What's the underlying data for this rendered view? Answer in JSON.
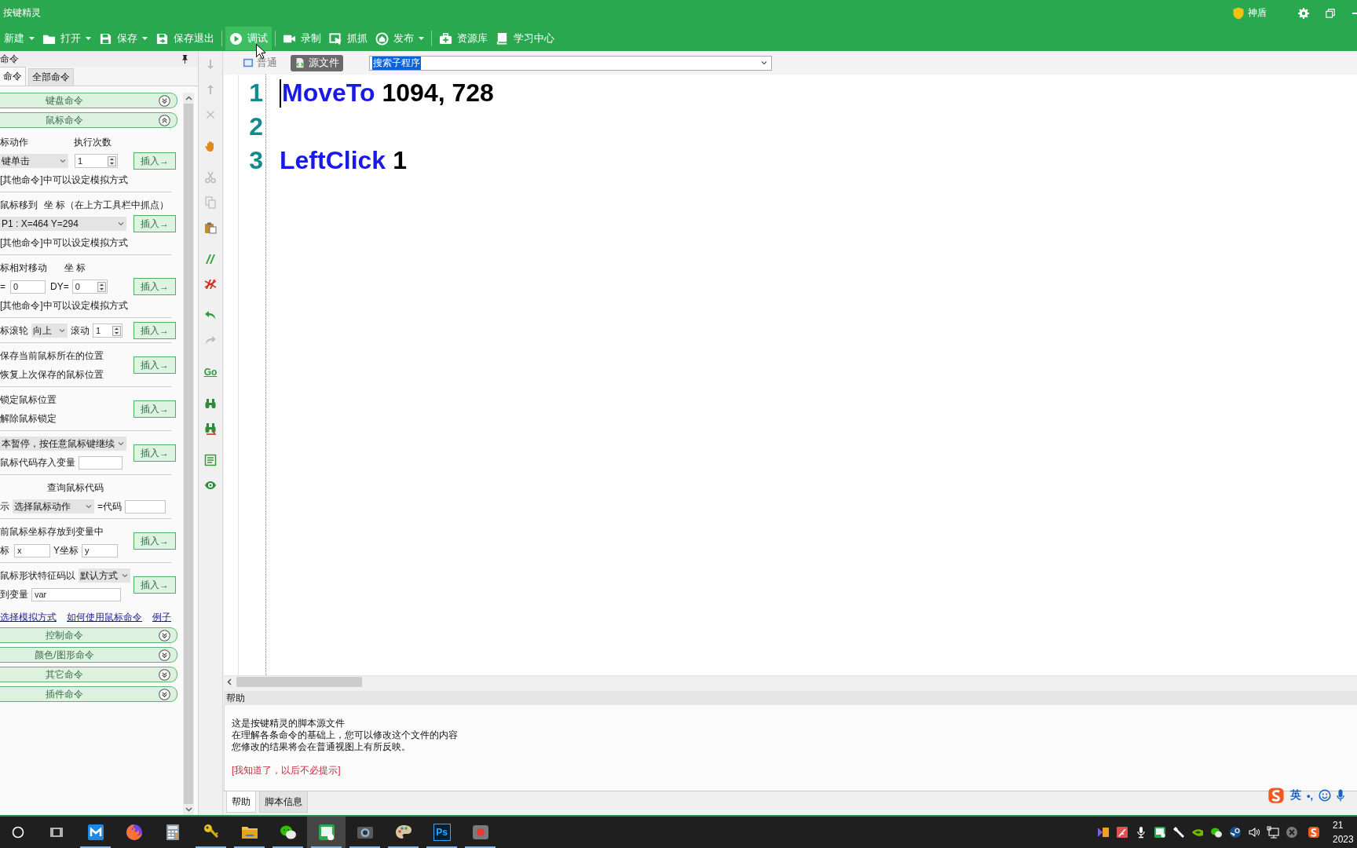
{
  "window": {
    "title": "按键精灵",
    "shield_label": "神盾"
  },
  "toolbar": {
    "groups": [
      {
        "items": [
          {
            "label": "新建",
            "dropdown": true,
            "highlighted": false
          },
          {
            "label": "打开",
            "dropdown": true,
            "highlighted": false
          },
          {
            "label": "保存",
            "dropdown": true,
            "highlighted": false
          },
          {
            "label": "保存退出",
            "dropdown": false,
            "highlighted": false
          }
        ]
      },
      {
        "items": [
          {
            "label": "调试",
            "dropdown": false,
            "highlighted": true
          }
        ]
      },
      {
        "items": [
          {
            "label": "录制",
            "dropdown": false,
            "highlighted": false
          },
          {
            "label": "抓抓",
            "dropdown": false,
            "highlighted": false
          },
          {
            "label": "发布",
            "dropdown": true,
            "highlighted": false
          }
        ]
      },
      {
        "items": [
          {
            "label": "资源库",
            "dropdown": false,
            "highlighted": false
          },
          {
            "label": "学习中心",
            "dropdown": false,
            "highlighted": false
          }
        ]
      }
    ]
  },
  "command_panel": {
    "title": "命令",
    "tabs": [
      {
        "label": "命令",
        "selected": true
      },
      {
        "label": "全部命令",
        "selected": false
      }
    ],
    "categories_top": [
      {
        "label": "键盘命令",
        "expanded": false
      },
      {
        "label": "鼠标命令",
        "expanded": true
      }
    ],
    "sections": [
      {
        "rows": [
          {
            "parts": [
              {
                "kind": "text",
                "text": "标动作"
              },
              {
                "kind": "text",
                "text": "执行次数"
              }
            ]
          },
          {
            "parts": [
              {
                "kind": "select",
                "value": "键单击"
              },
              {
                "kind": "spin",
                "value": "1"
              }
            ]
          },
          {
            "parts": [
              {
                "kind": "text",
                "text": "[其他命令]中可以设定模拟方式"
              }
            ]
          }
        ],
        "button": "插入→"
      },
      {
        "rows": [
          {
            "parts": [
              {
                "kind": "text",
                "text": "鼠标移到"
              },
              {
                "kind": "text",
                "text": "坐 标（在上方工具栏中抓点）"
              }
            ]
          },
          {
            "parts": [
              {
                "kind": "select",
                "value": "P1 : X=464 Y=294"
              }
            ]
          },
          {
            "parts": [
              {
                "kind": "text",
                "text": "[其他命令]中可以设定模拟方式"
              }
            ]
          }
        ],
        "button": "插入→"
      },
      {
        "rows": [
          {
            "parts": [
              {
                "kind": "text",
                "text": "标相对移动"
              },
              {
                "kind": "text",
                "text": "坐 标"
              }
            ]
          },
          {
            "parts": [
              {
                "kind": "text",
                "text": "="
              },
              {
                "kind": "input",
                "value": "0"
              },
              {
                "kind": "text",
                "text": "DY="
              },
              {
                "kind": "spin",
                "value": "0"
              }
            ]
          },
          {
            "parts": [
              {
                "kind": "text",
                "text": "[其他命令]中可以设定模拟方式"
              }
            ]
          }
        ],
        "button": "插入→"
      },
      {
        "rows": [
          {
            "parts": [
              {
                "kind": "text",
                "text": "标滚轮"
              },
              {
                "kind": "select",
                "value": "向上"
              },
              {
                "kind": "text",
                "text": "滚动"
              },
              {
                "kind": "spin",
                "value": "1"
              }
            ]
          }
        ],
        "button": "插入→"
      },
      {
        "rows": [
          {
            "parts": [
              {
                "kind": "text",
                "text": "保存当前鼠标所在的位置"
              }
            ]
          },
          {
            "parts": [
              {
                "kind": "text",
                "text": "恢复上次保存的鼠标位置"
              }
            ]
          }
        ],
        "button": "插入→"
      },
      {
        "rows": [
          {
            "parts": [
              {
                "kind": "text",
                "text": "锁定鼠标位置"
              }
            ]
          },
          {
            "parts": [
              {
                "kind": "text",
                "text": "解除鼠标锁定"
              }
            ]
          }
        ],
        "button": "插入→"
      },
      {
        "rows": [
          {
            "parts": [
              {
                "kind": "select",
                "value": "本暂停，按任意鼠标键继续"
              }
            ]
          },
          {
            "parts": [
              {
                "kind": "text",
                "text": "鼠标代码存入变量"
              },
              {
                "kind": "input"
              }
            ]
          }
        ],
        "button": "插入→"
      },
      {
        "rows": [
          {
            "parts": [
              {
                "kind": "caption",
                "text": "查询鼠标代码"
              }
            ]
          },
          {
            "parts": [
              {
                "kind": "text",
                "text": "示"
              },
              {
                "kind": "select",
                "value": "选择鼠标动作"
              },
              {
                "kind": "text",
                "text": "=代码"
              },
              {
                "kind": "input"
              }
            ]
          }
        ]
      },
      {
        "rows": [
          {
            "parts": [
              {
                "kind": "text",
                "text": "前鼠标坐标存放到变量中"
              }
            ]
          },
          {
            "parts": [
              {
                "kind": "text",
                "text": "标"
              },
              {
                "kind": "input",
                "value": "x"
              },
              {
                "kind": "text",
                "text": "Y坐标"
              },
              {
                "kind": "input",
                "value": "y"
              }
            ]
          }
        ],
        "button": "插入→"
      },
      {
        "rows": [
          {
            "parts": [
              {
                "kind": "text",
                "text": "鼠标形状特征码以"
              },
              {
                "kind": "select",
                "value": "默认方式"
              }
            ]
          },
          {
            "parts": [
              {
                "kind": "text",
                "text": "到变量"
              },
              {
                "kind": "input",
                "value": "var"
              }
            ]
          }
        ],
        "button": "插入→"
      }
    ],
    "links": [
      "选择模拟方式",
      "如何使用鼠标命令",
      "例子"
    ],
    "categories_bottom": [
      {
        "label": "控制命令",
        "expanded": false
      },
      {
        "label": "颜色/图形命令",
        "expanded": false
      },
      {
        "label": "其它命令",
        "expanded": false
      },
      {
        "label": "插件命令",
        "expanded": false
      }
    ]
  },
  "edit_tools": [
    {
      "items": [
        {
          "disabled": true
        },
        {
          "disabled": true
        },
        {
          "disabled": true
        }
      ]
    },
    {
      "items": [
        {
          "disabled": false
        }
      ]
    },
    {
      "items": [
        {
          "disabled": true
        },
        {
          "disabled": true
        },
        {
          "disabled": false
        }
      ]
    },
    {
      "items": [
        {
          "disabled": false
        },
        {
          "disabled": false
        }
      ]
    },
    {
      "items": [
        {
          "disabled": false
        },
        {
          "disabled": true
        }
      ]
    },
    {
      "items": [
        {
          "disabled": false,
          "label": "Go"
        }
      ]
    },
    {
      "items": [
        {
          "disabled": false
        },
        {
          "disabled": false
        }
      ]
    },
    {
      "items": [
        {
          "disabled": false
        },
        {
          "disabled": false
        }
      ]
    }
  ],
  "editor": {
    "view_tabs": [
      {
        "label": "普通",
        "selected": false
      },
      {
        "label": "源文件",
        "selected": true
      }
    ],
    "search": {
      "value": "搜索子程序",
      "highlighted": true
    },
    "lines": [
      {
        "number": "1",
        "caret": true,
        "tokens": [
          {
            "kind": "keyword",
            "text": "MoveTo"
          },
          {
            "kind": "plain",
            "text": "1094, 728"
          }
        ]
      },
      {
        "number": "2",
        "caret": false
      },
      {
        "number": "3",
        "caret": false,
        "tokens": [
          {
            "kind": "keyword",
            "text": "LeftClick"
          },
          {
            "kind": "plain",
            "text": "1"
          }
        ]
      }
    ]
  },
  "help": {
    "title": "帮助",
    "lines": [
      "这是按键精灵的脚本源文件",
      "在理解各条命令的基础上，您可以修改这个文件的内容",
      "您修改的结果将会在普通视图上有所反映。"
    ],
    "link": "[我知道了，以后不必提示]",
    "tabs": [
      {
        "label": "帮助",
        "selected": true
      },
      {
        "label": "脚本信息",
        "selected": false
      }
    ]
  },
  "ime_bar": {
    "mode": "英",
    "punctuation": "•,"
  },
  "taskbar": {
    "apps": [
      {
        "running": true,
        "active": false
      },
      {
        "running": false,
        "active": false
      },
      {
        "running": false,
        "active": false
      },
      {
        "running": true,
        "active": false
      },
      {
        "running": true,
        "active": false
      },
      {
        "running": true,
        "active": false
      },
      {
        "running": true,
        "active": true
      },
      {
        "running": true,
        "active": false
      },
      {
        "running": true,
        "active": false
      },
      {
        "running": true,
        "active": false,
        "logo_text": "Ps"
      },
      {
        "running": true,
        "active": false
      }
    ],
    "clock": {
      "time": "21",
      "date": "2023"
    }
  }
}
